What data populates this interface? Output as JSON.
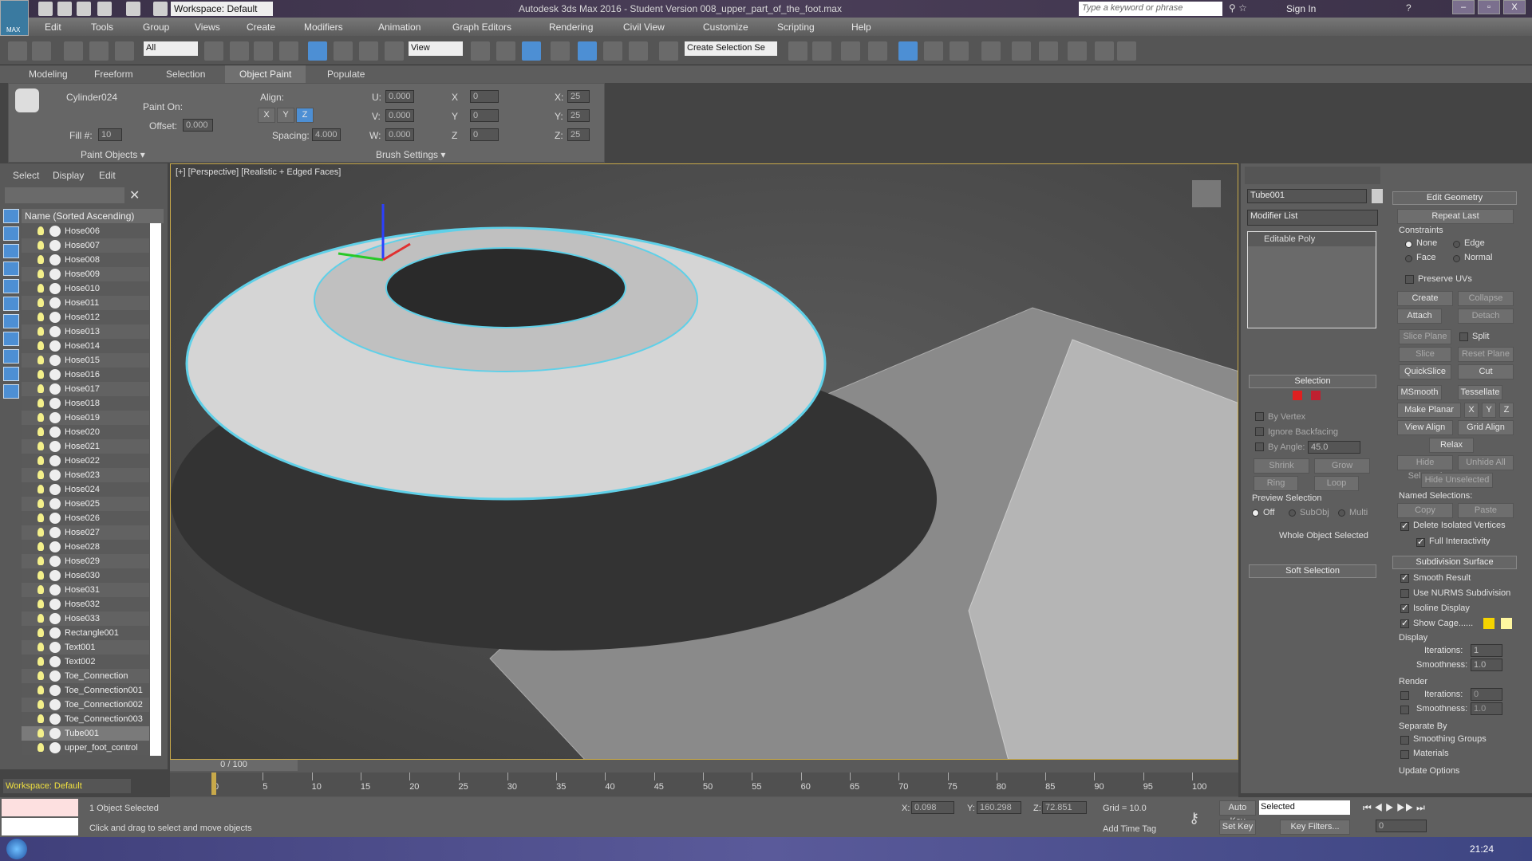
{
  "app": {
    "title": "Autodesk 3ds Max 2016 - Student Version    008_upper_part_of_the_foot.max",
    "logo": "MAX",
    "workspace": "Workspace: Default",
    "search_placeholder": "Type a keyword or phrase",
    "sign_in": "Sign In",
    "min": "–",
    "max": "▫",
    "close": "X"
  },
  "menu": [
    "Edit",
    "Tools",
    "Group",
    "Views",
    "Create",
    "Modifiers",
    "Animation",
    "Graph Editors",
    "Rendering",
    "Civil View",
    "Customize",
    "Scripting",
    "Help"
  ],
  "toolbar": {
    "filter": "All",
    "ref_coord": "View",
    "selection_set": "Create Selection Se"
  },
  "ribbon": {
    "tabs": [
      "Modeling",
      "Freeform",
      "Selection",
      "Object Paint",
      "Populate"
    ],
    "active": "Object Paint",
    "object": "Cylinder024",
    "paint_on": "Paint On:",
    "offset_label": "Offset:",
    "offset": "0.000",
    "fill_label": "Fill #:",
    "fill": "10",
    "align": "Align:",
    "x": "X",
    "y": "Y",
    "z": "Z",
    "spacing_label": "Spacing:",
    "spacing": "4.000",
    "u_label": "U:",
    "u": "0.000",
    "v_label": "V:",
    "v": "0.000",
    "w_label": "W:",
    "w": "0.000",
    "rx_label": "X",
    "rx": "0",
    "ry_label": "Y",
    "ry": "0",
    "rz_label": "Z",
    "rz": "0",
    "sx_label": "X:",
    "sx": "25",
    "sy_label": "Y:",
    "sy": "25",
    "sz_label": "Z:",
    "sz": "25",
    "group_paint": "Paint Objects ▾",
    "group_brush": "Brush Settings ▾"
  },
  "explorer": {
    "menus": [
      "Select",
      "Display",
      "Edit"
    ],
    "header": "Name (Sorted Ascending)",
    "items": [
      "Hose006",
      "Hose007",
      "Hose008",
      "Hose009",
      "Hose010",
      "Hose011",
      "Hose012",
      "Hose013",
      "Hose014",
      "Hose015",
      "Hose016",
      "Hose017",
      "Hose018",
      "Hose019",
      "Hose020",
      "Hose021",
      "Hose022",
      "Hose023",
      "Hose024",
      "Hose025",
      "Hose026",
      "Hose027",
      "Hose028",
      "Hose029",
      "Hose030",
      "Hose031",
      "Hose032",
      "Hose033",
      "Rectangle001",
      "Text001",
      "Text002",
      "Toe_Connection",
      "Toe_Connection001",
      "Toe_Connection002",
      "Toe_Connection003",
      "Tube001",
      "upper_foot_control"
    ],
    "selected": "Tube001",
    "workspace": "Workspace: Default"
  },
  "viewport": {
    "label": "[+] [Perspective] [Realistic + Edged Faces]",
    "accent": "#5fd0e8"
  },
  "command": {
    "object_name": "Tube001",
    "modifier_list": "Modifier List",
    "stack": [
      "Editable Poly"
    ],
    "selection": {
      "title": "Selection",
      "by_vertex": "By Vertex",
      "ignore_backfacing": "Ignore Backfacing",
      "by_angle": "By Angle:",
      "angle": "45.0",
      "shrink": "Shrink",
      "grow": "Grow",
      "ring": "Ring",
      "loop": "Loop",
      "preview": "Preview Selection",
      "off": "Off",
      "subobj": "SubObj",
      "multi": "Multi",
      "status": "Whole Object Selected"
    },
    "soft_selection": "Soft Selection",
    "edit_geometry": {
      "title": "Edit Geometry",
      "repeat_last": "Repeat Last",
      "constraints": "Constraints",
      "none": "None",
      "edge": "Edge",
      "face": "Face",
      "normal": "Normal",
      "preserve_uvs": "Preserve UVs",
      "create": "Create",
      "collapse": "Collapse",
      "attach": "Attach",
      "detach": "Detach",
      "slice_plane": "Slice Plane",
      "split": "Split",
      "slice": "Slice",
      "reset_plane": "Reset Plane",
      "quickslice": "QuickSlice",
      "cut": "Cut",
      "msmooth": "MSmooth",
      "tessellate": "Tessellate",
      "make_planar": "Make Planar",
      "x": "X",
      "y": "Y",
      "z": "Z",
      "view_align": "View Align",
      "grid_align": "Grid Align",
      "relax": "Relax",
      "hide_selected": "Hide Selected",
      "unhide_all": "Unhide All",
      "hide_unselected": "Hide Unselected",
      "named_selections": "Named Selections:",
      "copy": "Copy",
      "paste": "Paste",
      "delete_isolated": "Delete Isolated Vertices",
      "full_interactivity": "Full Interactivity"
    },
    "subdivision": {
      "title": "Subdivision Surface",
      "smooth_result": "Smooth Result",
      "use_nurms": "Use NURMS Subdivision",
      "isoline": "Isoline Display",
      "show_cage": "Show Cage......",
      "cage_color1": "#f5d400",
      "cage_color2": "#fff7a0",
      "display": "Display",
      "iterations": "Iterations:",
      "disp_iter": "1",
      "smoothness": "Smoothness:",
      "disp_smooth": "1.0",
      "render": "Render",
      "rend_iter": "0",
      "rend_smooth": "1.0",
      "separate_by": "Separate By",
      "smoothing_groups": "Smoothing Groups",
      "materials": "Materials",
      "update_options": "Update Options"
    }
  },
  "timeline": {
    "frame": "0 / 100",
    "ticks": [
      "0",
      "5",
      "10",
      "15",
      "20",
      "25",
      "30",
      "35",
      "40",
      "45",
      "50",
      "55",
      "60",
      "65",
      "70",
      "75",
      "80",
      "85",
      "90",
      "95",
      "100"
    ]
  },
  "status": {
    "selected": "1 Object Selected",
    "prompt": "Click and drag to select and move objects",
    "x_label": "X:",
    "x": "0.098",
    "y_label": "Y:",
    "y": "160.298",
    "z_label": "Z:",
    "z": "72.851",
    "grid": "Grid = 10.0",
    "add_time_tag": "Add Time Tag",
    "auto_key": "Auto Key",
    "set_key": "Set Key",
    "key_mode": "Selected",
    "key_filters": "Key Filters...",
    "current_frame": "0"
  },
  "taskbar": {
    "clock": "21:24"
  }
}
